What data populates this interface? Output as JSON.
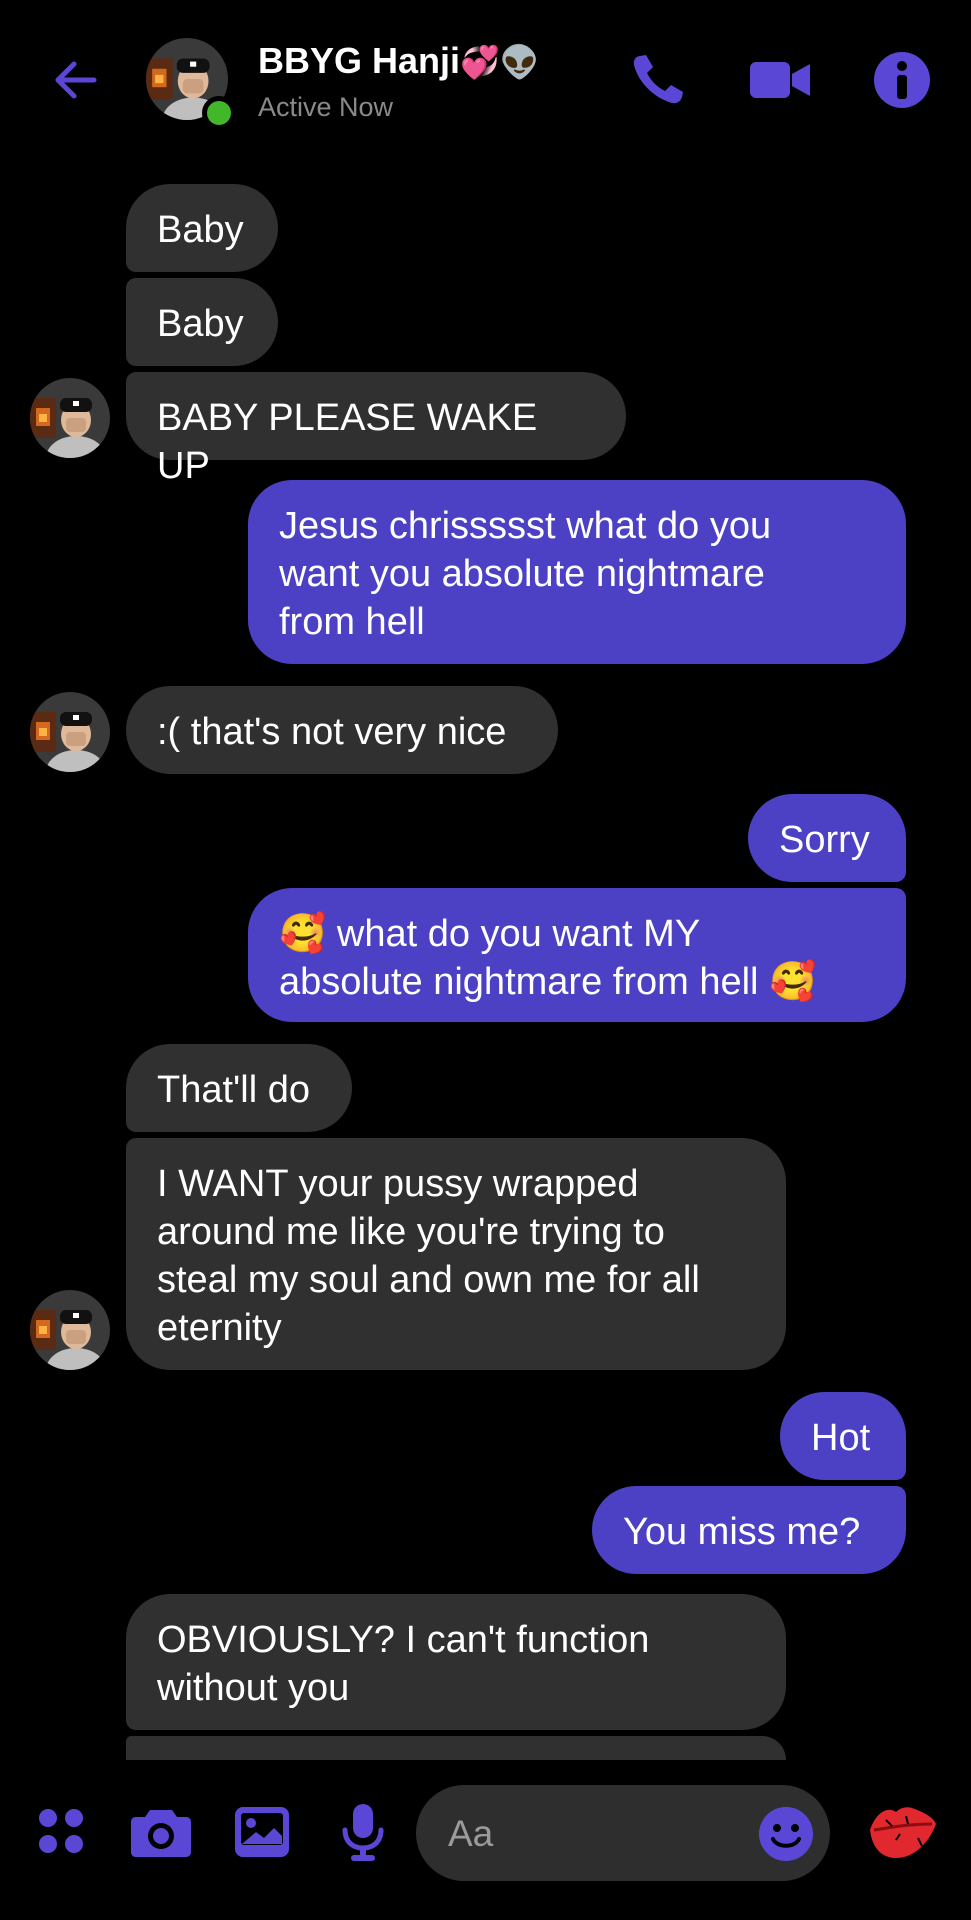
{
  "header": {
    "contact_name": "BBYG Hanji",
    "contact_name_emojis": "💞👽",
    "status": "Active Now",
    "accent_color": "#5b47d6"
  },
  "messages": [
    {
      "side": "in",
      "text": "Baby"
    },
    {
      "side": "in",
      "text": "Baby"
    },
    {
      "side": "in",
      "text": "BABY PLEASE WAKE UP"
    },
    {
      "side": "out",
      "lines": [
        "Jesus chrissssst what do you",
        "want you absolute nightmare",
        "from hell"
      ]
    },
    {
      "side": "in",
      "text": ":( that's not very nice"
    },
    {
      "side": "out",
      "text": "Sorry"
    },
    {
      "side": "out",
      "lines": [
        "🥰 what do you want MY",
        "absolute nightmare from hell 🥰"
      ]
    },
    {
      "side": "in",
      "text": "That'll do"
    },
    {
      "side": "in",
      "lines": [
        "I WANT your pussy wrapped",
        "around me like you're trying to",
        "steal my soul and own me for all",
        "eternity"
      ]
    },
    {
      "side": "out",
      "text": "Hot"
    },
    {
      "side": "out",
      "text": "You miss me?"
    },
    {
      "side": "in",
      "lines": [
        "OBVIOUSLY? I can't function",
        "without you"
      ]
    }
  ],
  "composer": {
    "placeholder": "Aa"
  },
  "icons": {
    "back": "arrow-left-icon",
    "call": "phone-icon",
    "video": "video-camera-icon",
    "info": "info-icon",
    "menu": "four-dots-icon",
    "camera": "camera-icon",
    "gallery": "image-icon",
    "mic": "microphone-icon",
    "emoji": "smiley-icon",
    "quick_reaction": "lips-kiss-icon"
  },
  "colors": {
    "background": "#000000",
    "incoming_bubble": "#303030",
    "outgoing_bubble": "#4c40c4",
    "accent": "#5b47d6",
    "online": "#42b72a"
  }
}
